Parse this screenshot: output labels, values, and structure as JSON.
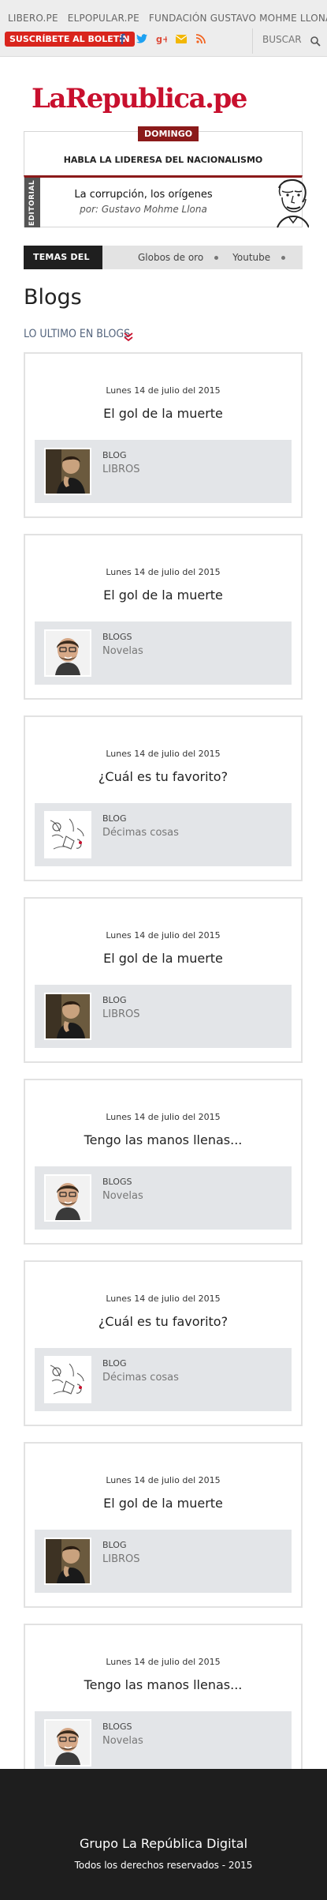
{
  "topnav": {
    "links": [
      "LIBERO.PE",
      "ELPOPULAR.PE",
      "FUNDACIÓN GUSTAVO MOHME LLONA"
    ],
    "subscribe_label": "SUSCRÍBETE AL BOLETÍN",
    "search_placeholder": "BUSCAR",
    "social_icons": [
      "facebook-icon",
      "twitter-icon",
      "google-plus-icon",
      "mail-icon",
      "rss-icon"
    ],
    "colors": {
      "facebook": "#3b5998",
      "twitter": "#1da1f2",
      "google": "#dd4b39",
      "mail": "#f2b705",
      "rss": "#f26522"
    }
  },
  "logo": {
    "text": "LaRepublica.pe",
    "color": "#c8102e"
  },
  "headline": {
    "day": "DOMINGO",
    "text": "HABLA LA LIDERESA DEL NACIONALISMO"
  },
  "editorial": {
    "tab": "EDITORIAL",
    "title": "La corrupción, los orígenes",
    "author": "por: Gustavo Mohme Llona"
  },
  "topics": {
    "label": "TEMAS DEL DÍA",
    "items": [
      "Globos de oro",
      "Youtube"
    ]
  },
  "page_title": "Blogs",
  "section_heading": "LO ULTIMO EN BLOGS",
  "cards": [
    {
      "date": "Lunes 14 de julio del 2015",
      "title": "El gol de la muerte",
      "label": "BLOG",
      "name": "LIBROS",
      "avatar": "thinking-man-portrait"
    },
    {
      "date": "Lunes 14 de julio del 2015",
      "title": "El gol de la muerte",
      "label": "BLOGS",
      "name": "Novelas",
      "avatar": "smiling-man-portrait"
    },
    {
      "date": "Lunes 14 de julio del 2015",
      "title": "¿Cuál es tu favorito?",
      "label": "BLOG",
      "name": "Décimas cosas",
      "avatar": "sketch-illustration"
    },
    {
      "date": "Lunes 14 de julio del 2015",
      "title": "El gol de la muerte",
      "label": "BLOG",
      "name": "LIBROS",
      "avatar": "thinking-man-portrait"
    },
    {
      "date": "Lunes 14 de julio del 2015",
      "title": "Tengo las manos llenas...",
      "label": "BLOGS",
      "name": "Novelas",
      "avatar": "smiling-man-portrait"
    },
    {
      "date": "Lunes 14 de julio del 2015",
      "title": "¿Cuál es tu favorito?",
      "label": "BLOG",
      "name": "Décimas cosas",
      "avatar": "sketch-illustration"
    },
    {
      "date": "Lunes 14 de julio del 2015",
      "title": "El gol de la muerte",
      "label": "BLOG",
      "name": "LIBROS",
      "avatar": "thinking-man-portrait"
    },
    {
      "date": "Lunes 14 de julio del 2015",
      "title": "Tengo las manos llenas...",
      "label": "BLOGS",
      "name": "Novelas",
      "avatar": "smiling-man-portrait"
    }
  ],
  "footer": {
    "title": "Grupo La República Digital",
    "copyright": "Todos los derechos reservados - 2015"
  }
}
